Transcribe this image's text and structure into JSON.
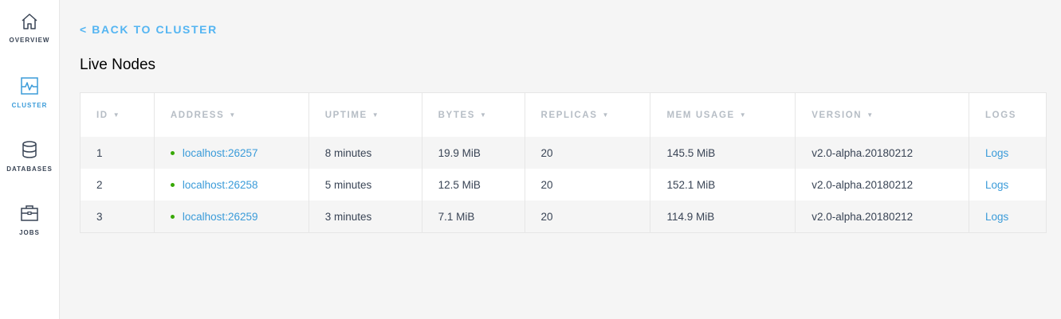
{
  "sidebar": {
    "items": [
      {
        "label": "OVERVIEW",
        "icon": "home-icon"
      },
      {
        "label": "CLUSTER",
        "icon": "pulse-icon",
        "active": true
      },
      {
        "label": "DATABASES",
        "icon": "database-icon"
      },
      {
        "label": "JOBS",
        "icon": "briefcase-icon"
      }
    ]
  },
  "main": {
    "back_link": "< BACK TO CLUSTER",
    "title": "Live Nodes"
  },
  "table": {
    "headers": [
      "ID",
      "ADDRESS",
      "UPTIME",
      "BYTES",
      "REPLICAS",
      "MEM USAGE",
      "VERSION",
      "LOGS"
    ],
    "sort_arrow": "▼",
    "rows": [
      {
        "id": "1",
        "address": "localhost:26257",
        "uptime": "8 minutes",
        "bytes": "19.9 MiB",
        "replicas": "20",
        "mem": "145.5 MiB",
        "version": "v2.0-alpha.20180212",
        "logs": "Logs"
      },
      {
        "id": "2",
        "address": "localhost:26258",
        "uptime": "5 minutes",
        "bytes": "12.5 MiB",
        "replicas": "20",
        "mem": "152.1 MiB",
        "version": "v2.0-alpha.20180212",
        "logs": "Logs"
      },
      {
        "id": "3",
        "address": "localhost:26259",
        "uptime": "3 minutes",
        "bytes": "7.1 MiB",
        "replicas": "20",
        "mem": "114.9 MiB",
        "version": "v2.0-alpha.20180212",
        "logs": "Logs"
      }
    ]
  },
  "colors": {
    "accent": "#54b5f2",
    "link": "#3a9bd9",
    "live_status": "#37a806"
  }
}
